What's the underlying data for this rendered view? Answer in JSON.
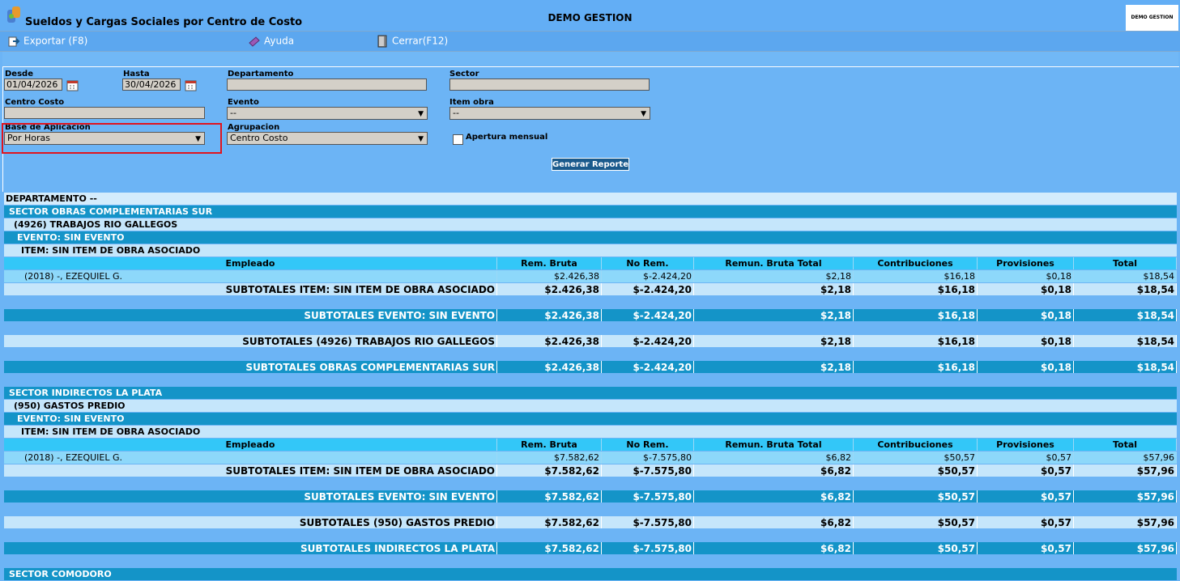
{
  "window": {
    "title": "Sueldos y Cargas Sociales por Centro de Costo",
    "company": "DEMO GESTION",
    "brand_box": "DEMO GESTION"
  },
  "toolbar": {
    "export": "Exportar (F8)",
    "help": "Ayuda",
    "close": "Cerrar(F12)"
  },
  "filters": {
    "desde_label": "Desde",
    "desde_value": "01/04/2026",
    "hasta_label": "Hasta",
    "hasta_value": "30/04/2026",
    "departamento_label": "Departamento",
    "sector_label": "Sector",
    "centro_costo_label": "Centro Costo",
    "evento_label": "Evento",
    "evento_value": "--",
    "item_obra_label": "Item obra",
    "item_obra_value": "--",
    "base_label": "Base de Aplicacion",
    "base_value": "Por Horas",
    "agrupacion_label": "Agrupacion",
    "agrupacion_value": "Centro Costo",
    "apertura_label": "Apertura mensual",
    "generate_button": "Generar Reporte"
  },
  "columns": [
    "Empleado",
    "Rem. Bruta",
    "No Rem.",
    "Remun. Bruta Total",
    "Contribuciones",
    "Provisiones",
    "Total"
  ],
  "report": {
    "department": "DEPARTAMENTO --",
    "groups": [
      {
        "sector": "SECTOR OBRAS COMPLEMENTARIAS SUR",
        "cost_center": "(4926) TRABAJOS RIO GALLEGOS",
        "event": "EVENTO: SIN EVENTO",
        "item": "ITEM: SIN ITEM DE OBRA ASOCIADO",
        "employee": [
          "(2018) -, EZEQUIEL G.",
          "$2.426,38",
          "$-2.424,20",
          "$2,18",
          "$16,18",
          "$0,18",
          "$18,54"
        ],
        "sub_item": [
          "SUBTOTALES ITEM: SIN ITEM DE OBRA ASOCIADO",
          "$2.426,38",
          "$-2.424,20",
          "$2,18",
          "$16,18",
          "$0,18",
          "$18,54"
        ],
        "sub_event": [
          "SUBTOTALES EVENTO: SIN EVENTO",
          "$2.426,38",
          "$-2.424,20",
          "$2,18",
          "$16,18",
          "$0,18",
          "$18,54"
        ],
        "sub_cc": [
          "SUBTOTALES (4926) TRABAJOS RIO GALLEGOS",
          "$2.426,38",
          "$-2.424,20",
          "$2,18",
          "$16,18",
          "$0,18",
          "$18,54"
        ],
        "sub_sector": [
          "SUBTOTALES OBRAS COMPLEMENTARIAS SUR",
          "$2.426,38",
          "$-2.424,20",
          "$2,18",
          "$16,18",
          "$0,18",
          "$18,54"
        ]
      },
      {
        "sector": "SECTOR INDIRECTOS LA PLATA",
        "cost_center": "(950) GASTOS PREDIO",
        "event": "EVENTO: SIN EVENTO",
        "item": "ITEM: SIN ITEM DE OBRA ASOCIADO",
        "employee": [
          "(2018) -, EZEQUIEL G.",
          "$7.582,62",
          "$-7.575,80",
          "$6,82",
          "$50,57",
          "$0,57",
          "$57,96"
        ],
        "sub_item": [
          "SUBTOTALES ITEM: SIN ITEM DE OBRA ASOCIADO",
          "$7.582,62",
          "$-7.575,80",
          "$6,82",
          "$50,57",
          "$0,57",
          "$57,96"
        ],
        "sub_event": [
          "SUBTOTALES EVENTO: SIN EVENTO",
          "$7.582,62",
          "$-7.575,80",
          "$6,82",
          "$50,57",
          "$0,57",
          "$57,96"
        ],
        "sub_cc": [
          "SUBTOTALES (950) GASTOS PREDIO",
          "$7.582,62",
          "$-7.575,80",
          "$6,82",
          "$50,57",
          "$0,57",
          "$57,96"
        ],
        "sub_sector": [
          "SUBTOTALES INDIRECTOS LA PLATA",
          "$7.582,62",
          "$-7.575,80",
          "$6,82",
          "$50,57",
          "$0,57",
          "$57,96"
        ]
      }
    ],
    "next_sector": "SECTOR COMODORO"
  }
}
